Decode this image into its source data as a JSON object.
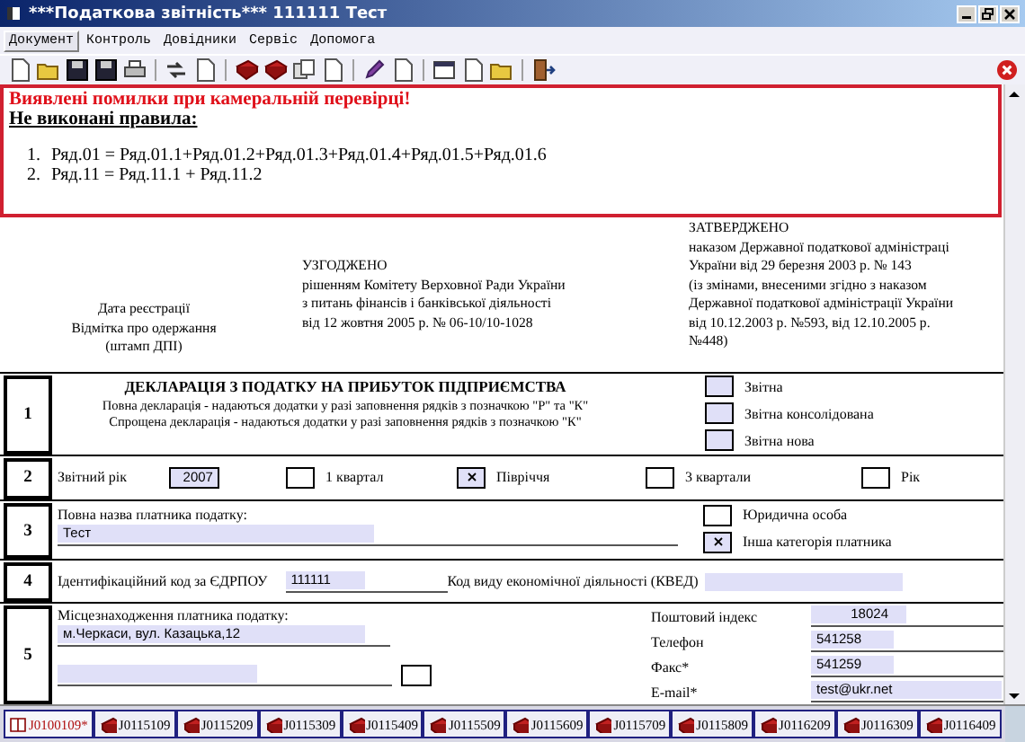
{
  "window": {
    "title": "***Податкова звітність*** 111111 Тест"
  },
  "menu": [
    {
      "label": "Документ",
      "selected": true
    },
    {
      "label": "Контроль",
      "selected": false
    },
    {
      "label": "Довідники",
      "selected": false
    },
    {
      "label": "Сервіс",
      "selected": false
    },
    {
      "label": "Допомога",
      "selected": false
    }
  ],
  "errors": {
    "heading": "Виявлені помилки при камеральній перевірці!",
    "subheading": "Не виконані правила:",
    "items": [
      {
        "number": "1.",
        "text": "Ряд.01 = Ряд.01.1+Ряд.01.2+Ряд.01.3+Ряд.01.4+Ряд.01.5+Ряд.01.6"
      },
      {
        "number": "2.",
        "text": "Ряд.11 = Ряд.11.1 + Ряд.11.2"
      }
    ]
  },
  "header": {
    "stamp": [
      "Дата реєстрації",
      "Відмітка про одержання",
      "(штамп ДПІ)"
    ],
    "agreed": [
      "УЗГОДЖЕНО",
      "рішенням Комітету Верховної Ради України",
      "з питань фінансів і банківської діяльності",
      "від 12 жовтня 2005 р. № 06-10/10-1028"
    ],
    "approved": [
      "ЗАТВЕРДЖЕНО",
      "наказом Державної податкової адміністраці",
      "України від 29 березня 2003 р. № 143",
      "(із змінами, внесеними згідно з наказом",
      "Державної податкової адміністрації України",
      "від 10.12.2003 р. №593, від 12.10.2005 р.",
      "№448)"
    ]
  },
  "section_1": {
    "number": "1",
    "title": "ДЕКЛАРАЦІЯ З ПОДАТКУ НА ПРИБУТОК ПІДПРИЄМСТВА",
    "notes": [
      "Повна декларація - надаються додатки у разі заповнення рядків з позначкою \"Р\" та \"К\"",
      "Спрощена декларація - надаються додатки у разі заповнення рядків з позначкою \"К\""
    ],
    "types": [
      {
        "label": "Звітна",
        "checked": false
      },
      {
        "label": "Звітна консолідована",
        "checked": false
      },
      {
        "label": "Звітна нова",
        "checked": false
      }
    ]
  },
  "section_2": {
    "number": "2",
    "label": "Звітний рік",
    "year": "2007",
    "periods": [
      {
        "label": "1 квартал",
        "checked": false
      },
      {
        "label": "Півріччя",
        "checked": true
      },
      {
        "label": "3 квартали",
        "checked": false
      },
      {
        "label": "Рік",
        "checked": false
      }
    ]
  },
  "section_3": {
    "number": "3",
    "label": "Повна назва платника податку:",
    "value": "Тест",
    "categories": [
      {
        "label": "Юридична особа",
        "checked": false
      },
      {
        "label": "Інша категорія платника",
        "checked": true
      }
    ]
  },
  "section_4": {
    "number": "4",
    "edrpou_label": "Ідентифікаційний код за ЄДРПОУ",
    "edrpou": "111111",
    "kved_label": "Код виду економічної діяльності (КВЕД)"
  },
  "section_5": {
    "number": "5",
    "address_label": "Місцезнаходження платника податку:",
    "address": "м.Черкаси, вул. Казацька,12",
    "extra_box": {
      "checked": false
    },
    "contacts": [
      {
        "label": "Поштовий індекс",
        "value": "18024"
      },
      {
        "label": "Телефон",
        "value": "541258"
      },
      {
        "label": "Факс*",
        "value": "541259"
      },
      {
        "label": "E-mail*",
        "value": "test@ukr.net"
      }
    ]
  },
  "tabs": [
    {
      "label": "J0100109*",
      "selected": true
    },
    {
      "label": "J0115109",
      "selected": false
    },
    {
      "label": "J0115209",
      "selected": false
    },
    {
      "label": "J0115309",
      "selected": false
    },
    {
      "label": "J0115409",
      "selected": false
    },
    {
      "label": "J0115509",
      "selected": false
    },
    {
      "label": "J0115609",
      "selected": false
    },
    {
      "label": "J0115709",
      "selected": false
    },
    {
      "label": "J0115809",
      "selected": false
    },
    {
      "label": "J0116209",
      "selected": false
    },
    {
      "label": "J0116309",
      "selected": false
    },
    {
      "label": "J0116409",
      "selected": false
    }
  ]
}
